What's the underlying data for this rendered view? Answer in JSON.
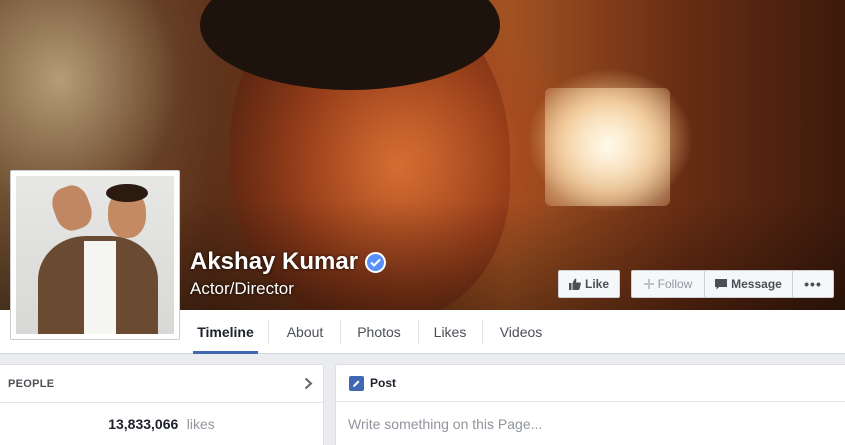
{
  "page": {
    "name": "Akshay Kumar",
    "category": "Actor/Director",
    "verified": true
  },
  "cover": {
    "icon": "cover-photo"
  },
  "actions": {
    "like_label": "Like",
    "follow_label": "Follow",
    "message_label": "Message",
    "more_label": "•••"
  },
  "tabs": [
    {
      "label": "Timeline",
      "active": true
    },
    {
      "label": "About",
      "active": false
    },
    {
      "label": "Photos",
      "active": false
    },
    {
      "label": "Likes",
      "active": false
    },
    {
      "label": "Videos",
      "active": false
    }
  ],
  "people_card": {
    "title": "PEOPLE",
    "likes_count": "13,833,066",
    "likes_label": "likes"
  },
  "composer": {
    "tab_label": "Post",
    "placeholder": "Write something on this Page..."
  },
  "colors": {
    "accent": "#4267b2",
    "verified": "#5890ff",
    "background": "#e9ebee"
  }
}
